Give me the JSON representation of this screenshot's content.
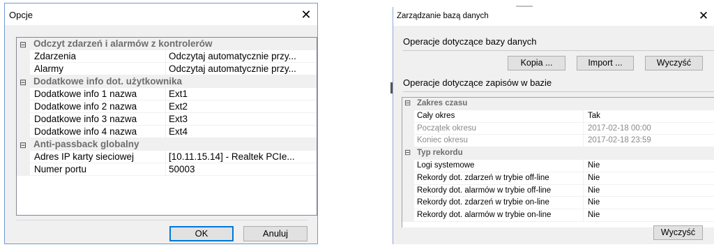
{
  "options_dialog": {
    "title": "Opcje",
    "close_glyph": "✕",
    "categories": [
      {
        "label": "Odczyt zdarzeń i alarmów z kontrolerów",
        "toggle": "⊟",
        "rows": [
          {
            "name": "Zdarzenia",
            "value": "Odczytaj automatycznie przy..."
          },
          {
            "name": "Alarmy",
            "value": "Odczytaj automatycznie przy..."
          }
        ]
      },
      {
        "label": "Dodatkowe info dot. użytkownika",
        "toggle": "⊟",
        "rows": [
          {
            "name": "Dodatkowe info 1 nazwa",
            "value": "Ext1"
          },
          {
            "name": "Dodatkowe info 2 nazwa",
            "value": "Ext2"
          },
          {
            "name": "Dodatkowe info 3 nazwa",
            "value": "Ext3"
          },
          {
            "name": "Dodatkowe info 4 nazwa",
            "value": "Ext4"
          }
        ]
      },
      {
        "label": "Anti-passback globalny",
        "toggle": "⊟",
        "rows": [
          {
            "name": "Adres IP karty sieciowej",
            "value": "[10.11.15.14] - Realtek PCIe..."
          },
          {
            "name": "Numer portu",
            "value": "50003"
          }
        ]
      }
    ],
    "ok_label": "OK",
    "cancel_label": "Anuluj"
  },
  "db_dialog": {
    "title": "Zarządzanie bazą danych",
    "close_glyph": "✕",
    "section_db": "Operacje dotyczące bazy danych",
    "backup_label": "Kopia ...",
    "import_label": "Import ...",
    "clear_db_label": "Wyczyść",
    "section_records": "Operacje dotyczące zapisów w bazie",
    "categories": [
      {
        "label": "Zakres czasu",
        "toggle": "⊟",
        "rows": [
          {
            "name": "Cały okres",
            "value": "Tak",
            "dim": false
          },
          {
            "name": "Początek okresu",
            "value": "2017-02-18 00:00",
            "dim": true
          },
          {
            "name": "Koniec okresu",
            "value": "2017-02-18 23:59",
            "dim": true
          }
        ]
      },
      {
        "label": "Typ rekordu",
        "toggle": "⊟",
        "rows": [
          {
            "name": "Logi systemowe",
            "value": "Nie",
            "dim": false
          },
          {
            "name": "Rekordy dot. zdarzeń w trybie off-line",
            "value": "Nie",
            "dim": false
          },
          {
            "name": "Rekordy dot. alarmów w trybie off-line",
            "value": "Nie",
            "dim": false
          },
          {
            "name": "Rekordy dot. zdarzeń w trybie on-line",
            "value": "Nie",
            "dim": false
          },
          {
            "name": "Rekordy dot. alarmów w trybie on-line",
            "value": "Nie",
            "dim": false
          }
        ]
      }
    ],
    "clear_records_label": "Wyczyść"
  }
}
